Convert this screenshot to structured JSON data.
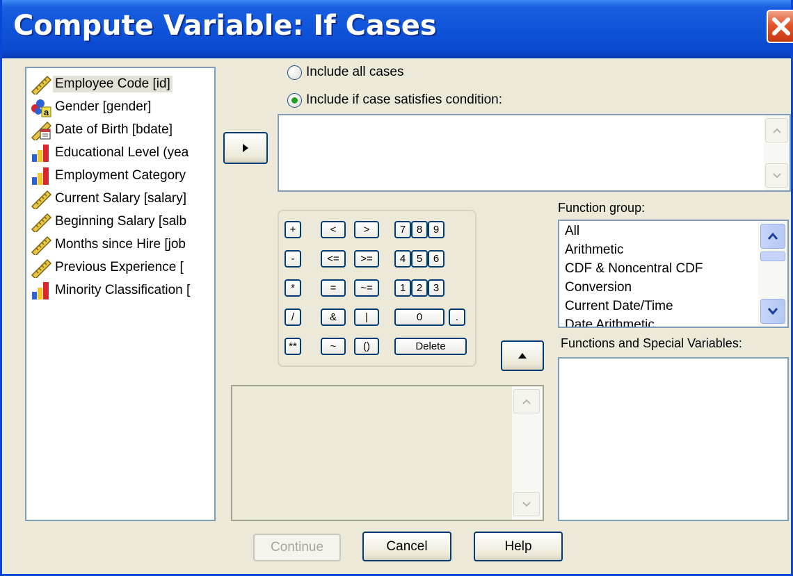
{
  "window": {
    "title": "Compute Variable: If Cases"
  },
  "variables": [
    {
      "label": "Employee Code [id]",
      "icon": "scale-ruler-icon",
      "selected": true
    },
    {
      "label": "Gender [gender]",
      "icon": "nominal-string-icon"
    },
    {
      "label": "Date of Birth [bdate]",
      "icon": "date-ruler-icon"
    },
    {
      "label": "Educational Level (yea",
      "icon": "ordinal-bars-icon"
    },
    {
      "label": "Employment Category",
      "icon": "ordinal-bars-icon"
    },
    {
      "label": "Current Salary [salary]",
      "icon": "scale-ruler-icon"
    },
    {
      "label": "Beginning Salary [salb",
      "icon": "scale-ruler-icon"
    },
    {
      "label": "Months since Hire [job",
      "icon": "scale-ruler-icon"
    },
    {
      "label": "Previous Experience [",
      "icon": "scale-ruler-icon"
    },
    {
      "label": "Minority Classification [",
      "icon": "ordinal-bars-icon"
    }
  ],
  "options": {
    "all_cases": "Include all cases",
    "if_condition": "Include if case satisfies condition:",
    "selected": "if_condition"
  },
  "condition": {
    "value": ""
  },
  "keypad": {
    "plus": "+",
    "lt": "<",
    "gt": ">",
    "k7": "7",
    "k8": "8",
    "k9": "9",
    "minus": "-",
    "le": "<=",
    "ge": ">=",
    "k4": "4",
    "k5": "5",
    "k6": "6",
    "mul": "*",
    "eq": "=",
    "ne": "~=",
    "k1": "1",
    "k2": "2",
    "k3": "3",
    "div": "/",
    "and": "&",
    "or": "|",
    "k0": "0",
    "dot": ".",
    "pow": "**",
    "not": "~",
    "paren": "()",
    "delete": "Delete"
  },
  "function_group": {
    "label": "Function group:",
    "items": [
      "All",
      "Arithmetic",
      "CDF & Noncentral CDF",
      "Conversion",
      "Current Date/Time",
      "Date Arithmetic"
    ]
  },
  "functions": {
    "label": "Functions and Special Variables:"
  },
  "buttons": {
    "continue": "Continue",
    "cancel": "Cancel",
    "help": "Help"
  },
  "colors": {
    "title_bar": "#0f54d9",
    "dialog_bg": "#ece9d8",
    "close": "#e2562c",
    "radio_dot": "#21a121"
  }
}
